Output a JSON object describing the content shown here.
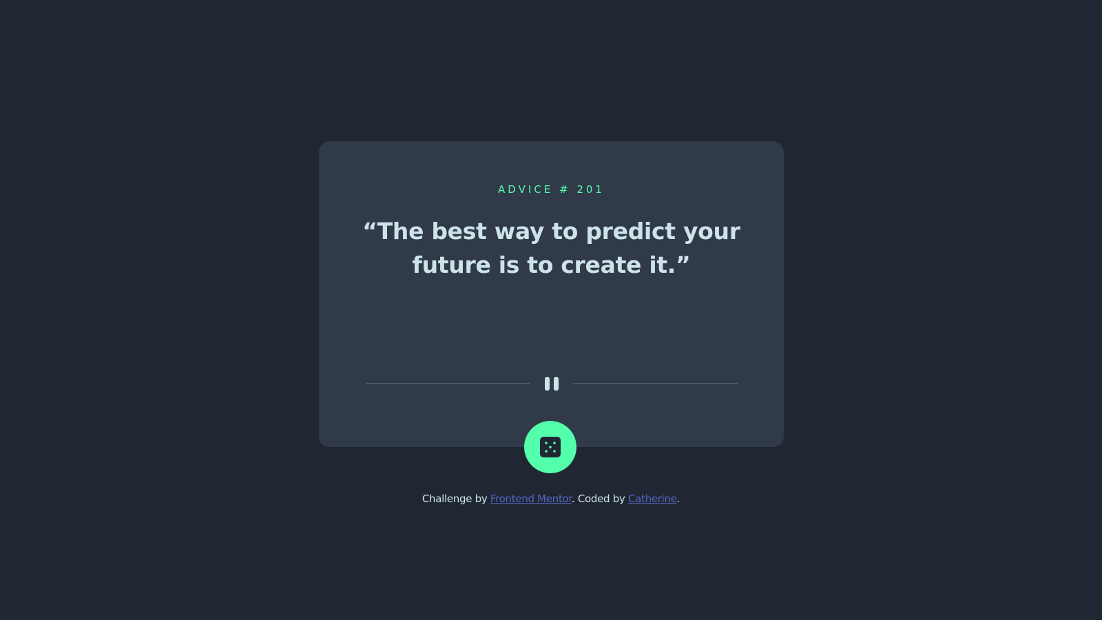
{
  "card": {
    "advice_label": "ADVICE # 201",
    "quote": "“The best way to predict your future is to create it.”"
  },
  "icons": {
    "divider": "pause-icon",
    "dice": "dice-icon"
  },
  "footer": {
    "prefix": "Challenge by ",
    "link1": "Frontend Mentor",
    "middle": ". Coded by ",
    "link2": "Catherine",
    "suffix": "."
  },
  "colors": {
    "background": "#202733",
    "card": "#313a48",
    "accent": "#53ffab",
    "text": "#cee3e9",
    "link": "#5665c4",
    "divider": "#4f5d74"
  }
}
